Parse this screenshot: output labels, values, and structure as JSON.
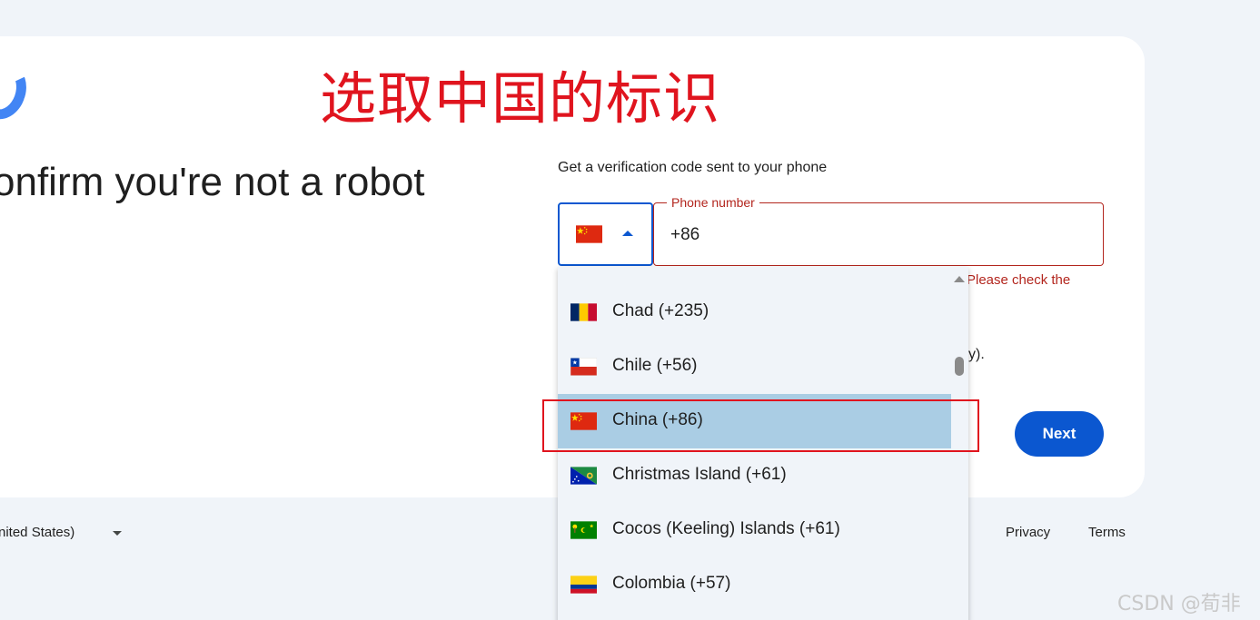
{
  "annotation_text": "选取中国的标识",
  "heading": "onfirm you're not a robot",
  "subtitle": "Get a verification code sent to your phone",
  "country_select": {
    "selected_flag": "china-flag-icon"
  },
  "phone": {
    "label": "Phone number",
    "value": "+86",
    "error": "Please check the"
  },
  "hidden_text_fragment": "y).",
  "next_label": "Next",
  "footer": {
    "language": "nited States)",
    "privacy": "Privacy",
    "terms": "Terms"
  },
  "dropdown": {
    "options": [
      {
        "label": "Chad (+235)",
        "flag": "chad-flag-icon"
      },
      {
        "label": "Chile (+56)",
        "flag": "chile-flag-icon"
      },
      {
        "label": "China (+86)",
        "flag": "china-flag-icon",
        "selected": true
      },
      {
        "label": "Christmas Island (+61)",
        "flag": "christmas-island-flag-icon"
      },
      {
        "label": "Cocos (Keeling) Islands (+61)",
        "flag": "cocos-islands-flag-icon"
      },
      {
        "label": "Colombia (+57)",
        "flag": "colombia-flag-icon"
      }
    ]
  },
  "watermark": "CSDN @荀非",
  "colors": {
    "accent": "#0b57d0",
    "error": "#b3261e",
    "annotation": "#e0141e",
    "selected_option": "#aacde4"
  }
}
